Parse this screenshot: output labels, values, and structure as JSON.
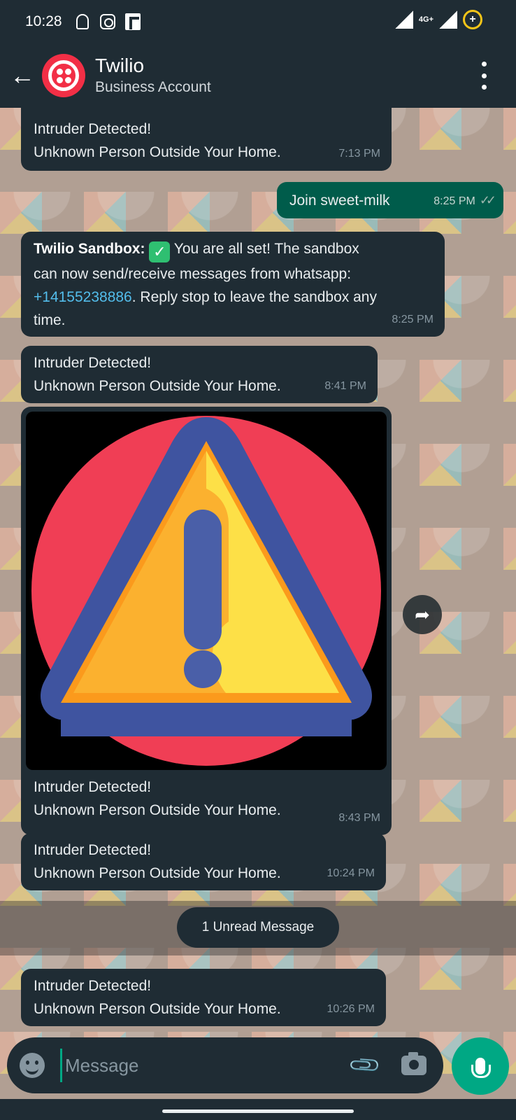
{
  "status_bar": {
    "time": "10:28",
    "network": "4G+",
    "icons": [
      "ghost-icon",
      "instagram-icon",
      "flipboard-icon",
      "signal-icon",
      "battery-saver-icon"
    ]
  },
  "header": {
    "back_icon": "arrow-left-icon",
    "contact_name": "Twilio",
    "subtitle": "Business Account",
    "menu_icon": "more-vert-icon"
  },
  "messages": [
    {
      "direction": "in",
      "lines": [
        "Intruder Detected!",
        "Unknown Person Outside Your Home."
      ],
      "time": "7:13 PM"
    },
    {
      "direction": "out",
      "lines": [
        "Join sweet-milk"
      ],
      "time": "8:25 PM",
      "status": "read"
    },
    {
      "direction": "in",
      "sender": "Twilio Sandbox:",
      "line1_rest": " You are all set! The sandbox",
      "line2": "can now send/receive messages from whatsapp:",
      "phone": "+14155238886",
      "line3_rest": ". Reply stop to leave the sandbox any",
      "line4": "time.",
      "time": "8:25 PM"
    },
    {
      "direction": "in",
      "lines": [
        "Intruder Detected!",
        "Unknown Person Outside Your Home."
      ],
      "time": "8:41 PM"
    },
    {
      "direction": "in",
      "media": "warning-image",
      "lines": [
        "Intruder Detected!",
        "Unknown Person Outside Your Home."
      ],
      "time": "8:43 PM"
    },
    {
      "direction": "in",
      "lines": [
        "Intruder Detected!",
        "Unknown Person Outside Your Home."
      ],
      "time": "10:24 PM"
    },
    {
      "direction": "in",
      "lines": [
        "Intruder Detected!",
        "Unknown Person Outside Your Home."
      ],
      "time": "10:26 PM"
    }
  ],
  "unread_banner": "1 Unread Message",
  "composer": {
    "placeholder": "Message",
    "emoji_icon": "emoji-icon",
    "attach_icon": "paperclip-icon",
    "camera_icon": "camera-icon",
    "mic_icon": "microphone-icon"
  },
  "colors": {
    "header_bg": "#1f2c34",
    "incoming_bubble": "#1f2c34",
    "outgoing_bubble": "#005c4b",
    "accent": "#00a884",
    "link": "#53bdeb",
    "twilio_red": "#f22f46"
  }
}
